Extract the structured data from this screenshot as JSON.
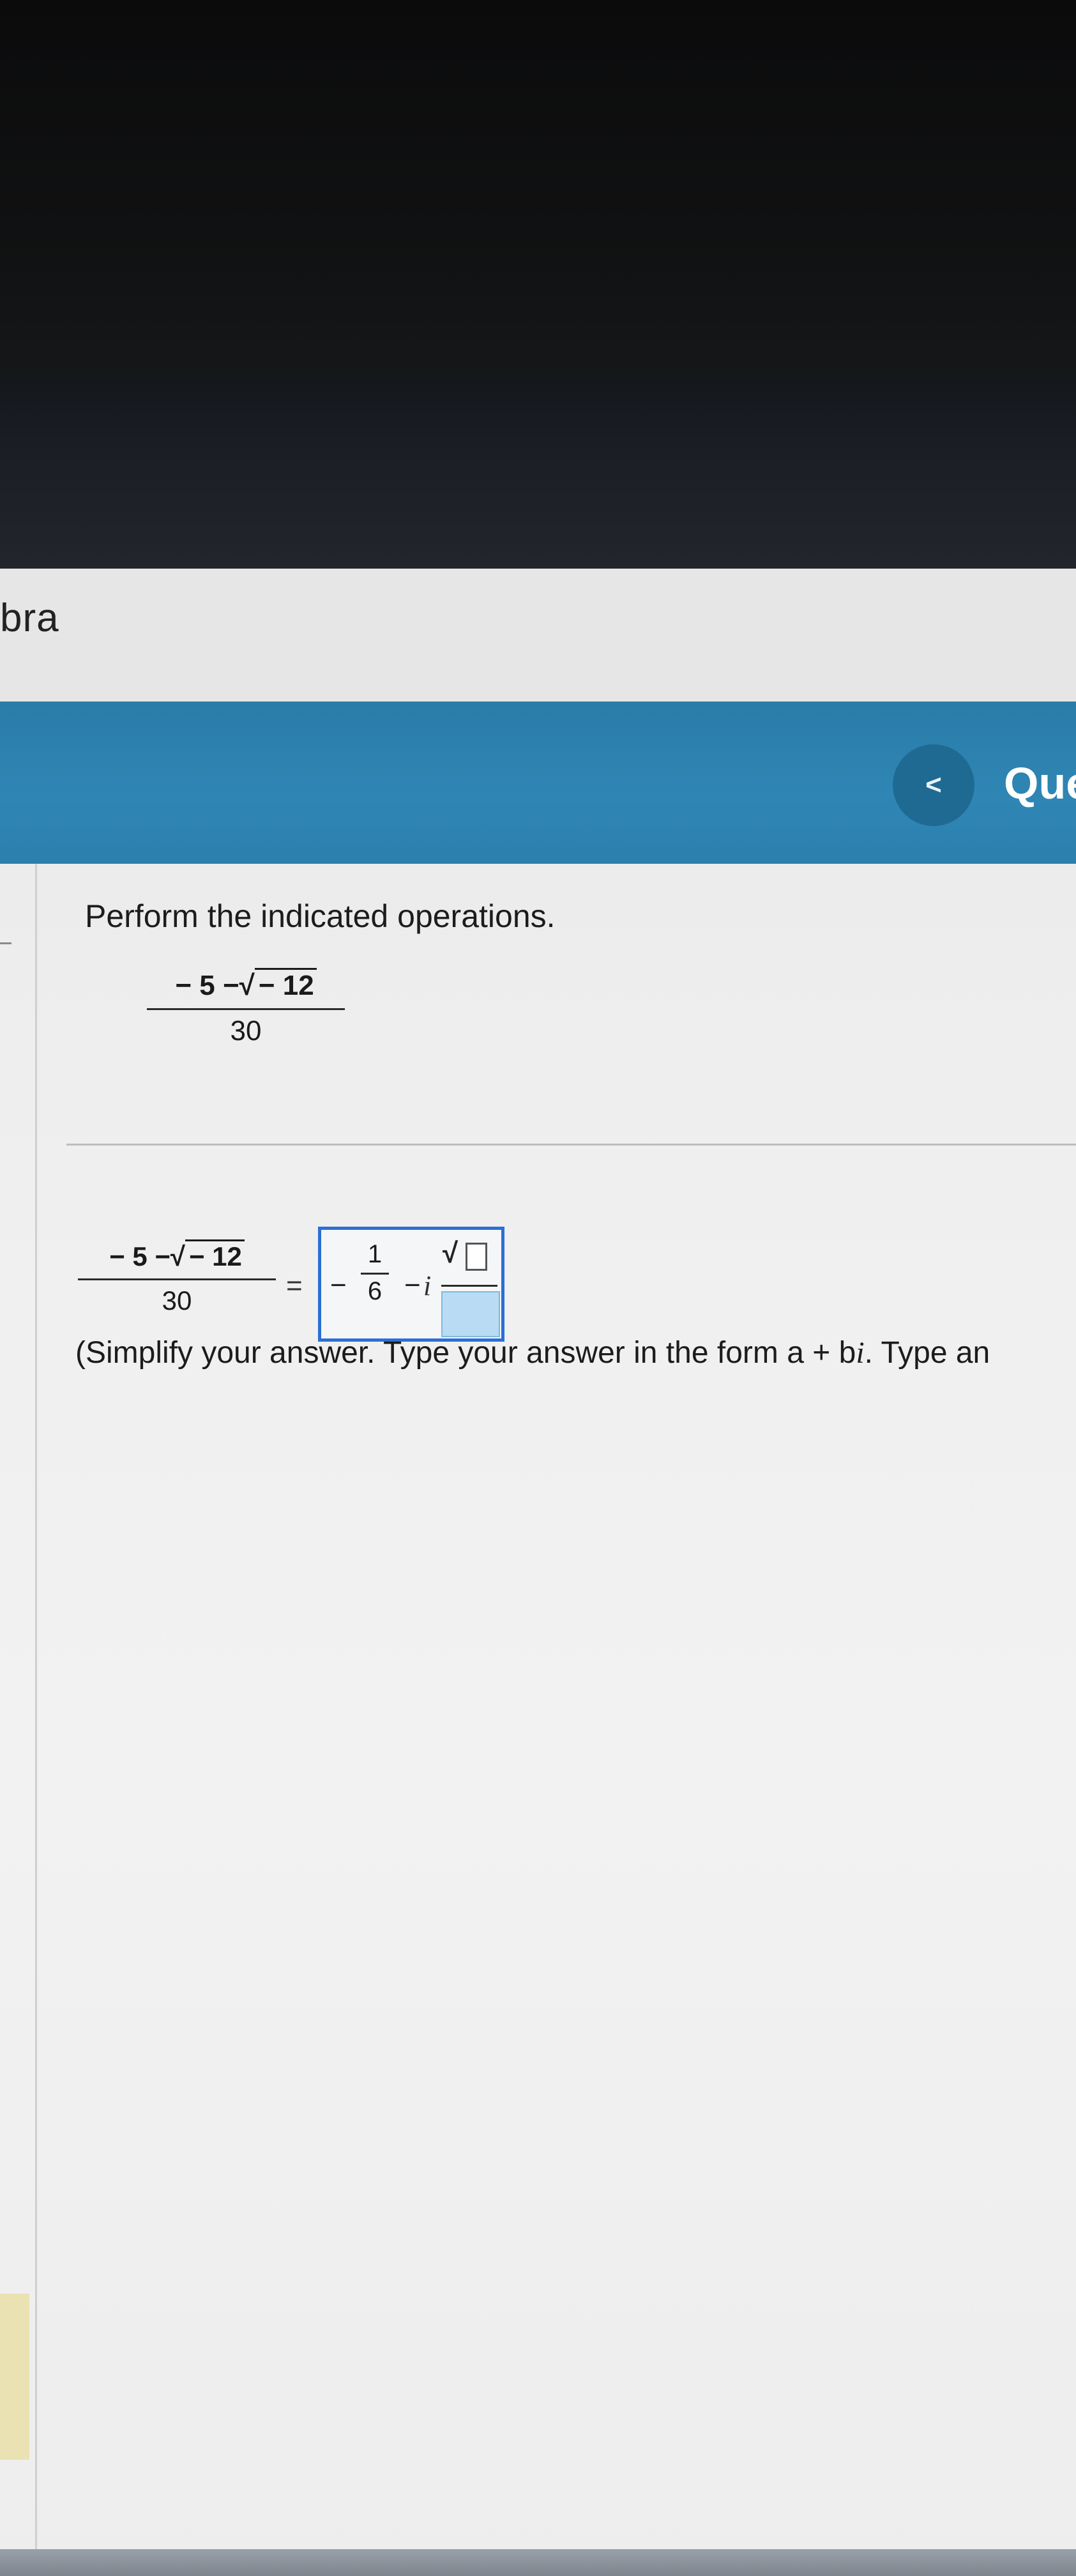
{
  "header": {
    "course_label": "bra",
    "nav_prev_label": "<",
    "question_nav_label": "Que"
  },
  "problem": {
    "instruction": "Perform the indicated operations.",
    "expression": {
      "numerator_lead": "− 5 −",
      "radical_symbol": "√",
      "radicand": "− 12",
      "denominator": "30"
    }
  },
  "answer": {
    "lhs": {
      "numerator_lead": "− 5 −",
      "radical_symbol": "√",
      "radicand": "− 12",
      "denominator": "30"
    },
    "equals": "=",
    "input": {
      "sign": "−",
      "frac_numerator": "1",
      "frac_denominator": "6",
      "operator": "−",
      "imaginary_unit": "i",
      "radical_symbol": "√",
      "radicand_value": "",
      "denominator_value": ""
    },
    "hint": "(Simplify your answer. Type your answer in the form a + b",
    "hint_i": "i",
    "hint_tail": ". Type an"
  },
  "colors": {
    "nav_bar": "#2f86b4",
    "nav_button": "#1f6a93",
    "answer_box_border": "#2b6fd6",
    "active_input_fill": "#b9dbf3"
  }
}
